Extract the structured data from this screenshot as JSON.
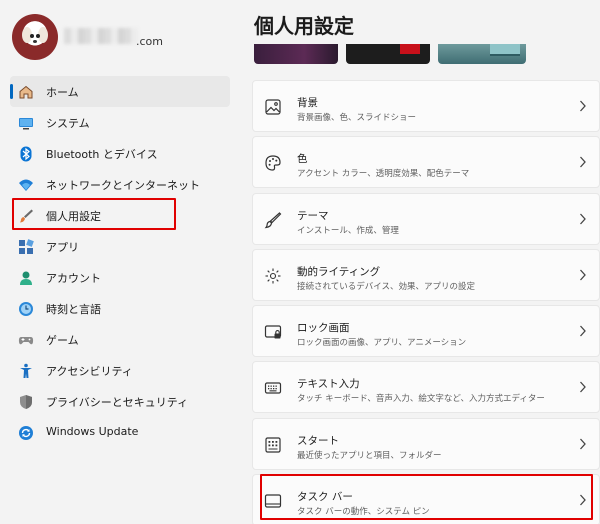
{
  "profile": {
    "email_domain": ".com"
  },
  "sidebar": {
    "items": [
      {
        "label": "ホーム",
        "icon": "home-icon"
      },
      {
        "label": "システム",
        "icon": "monitor-icon"
      },
      {
        "label": "Bluetooth とデバイス",
        "icon": "bluetooth-icon"
      },
      {
        "label": "ネットワークとインターネット",
        "icon": "wifi-icon"
      },
      {
        "label": "個人用設定",
        "icon": "brush-icon"
      },
      {
        "label": "アプリ",
        "icon": "apps-icon"
      },
      {
        "label": "アカウント",
        "icon": "person-icon"
      },
      {
        "label": "時刻と言語",
        "icon": "clock-globe-icon"
      },
      {
        "label": "ゲーム",
        "icon": "gamepad-icon"
      },
      {
        "label": "アクセシビリティ",
        "icon": "accessibility-icon"
      },
      {
        "label": "プライバシーとセキュリティ",
        "icon": "shield-icon"
      },
      {
        "label": "Windows Update",
        "icon": "update-icon"
      }
    ],
    "selected_index": 0,
    "highlighted_index": 4
  },
  "main": {
    "title": "個人用設定",
    "cards": [
      {
        "title": "背景",
        "subtitle": "背景画像、色、スライドショー",
        "icon": "picture-icon"
      },
      {
        "title": "色",
        "subtitle": "アクセント カラー、透明度効果、配色テーマ",
        "icon": "palette-icon"
      },
      {
        "title": "テーマ",
        "subtitle": "インストール、作成、管理",
        "icon": "brush-icon"
      },
      {
        "title": "動的ライティング",
        "subtitle": "接続されているデバイス、効果、アプリの設定",
        "icon": "lighting-icon"
      },
      {
        "title": "ロック画面",
        "subtitle": "ロック画面の画像、アプリ、アニメーション",
        "icon": "lock-screen-icon"
      },
      {
        "title": "テキスト入力",
        "subtitle": "タッチ キーボード、音声入力、絵文字など、入力方式エディター",
        "icon": "keyboard-icon"
      },
      {
        "title": "スタート",
        "subtitle": "最近使ったアプリと項目、フォルダー",
        "icon": "start-icon"
      },
      {
        "title": "タスク バー",
        "subtitle": "タスク バーの動作、システム ピン",
        "icon": "taskbar-icon"
      }
    ],
    "highlighted_card_index": 7
  },
  "colors": {
    "accent": "#0067c0",
    "highlight_box": "#e00000",
    "background": "#f3f3f3",
    "card": "#fbfbfb"
  }
}
